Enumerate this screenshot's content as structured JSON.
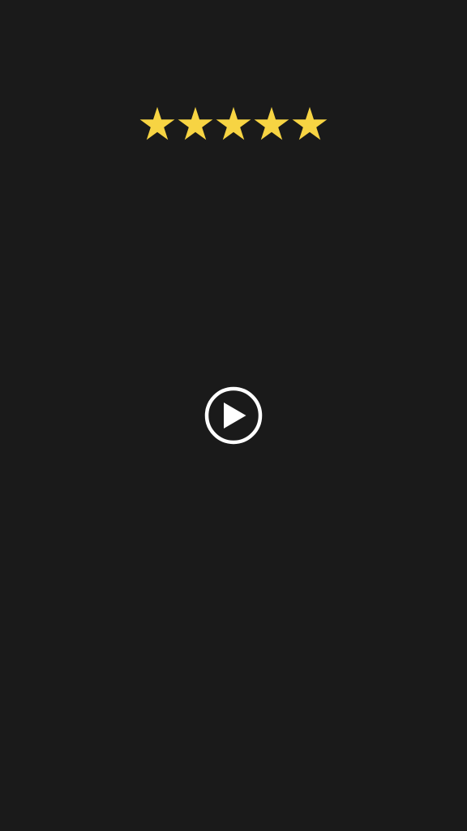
{
  "rating": {
    "value": 5,
    "max": 5,
    "star_color": "#f7d443",
    "star_icon": "star-icon"
  },
  "player": {
    "play_icon": "play-circle-icon",
    "icon_color": "#ffffff"
  },
  "theme": {
    "background": "#1a1a1a"
  }
}
